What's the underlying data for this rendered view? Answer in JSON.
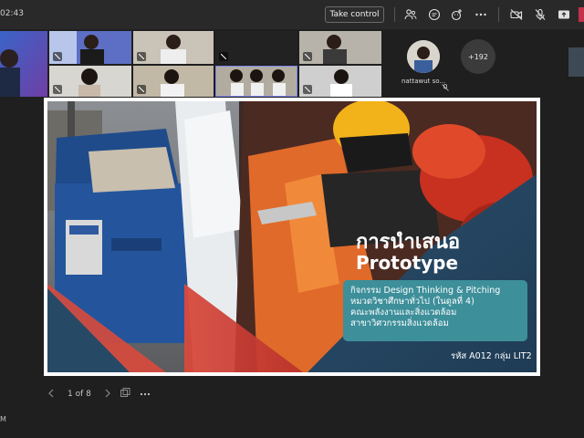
{
  "topbar": {
    "timer": "02:43",
    "take_control_label": "Take control",
    "icons": [
      "people-icon",
      "chat-icon",
      "reactions-icon",
      "more-icon",
      "camera-off-icon",
      "mic-off-icon",
      "share-icon",
      "leave-icon"
    ]
  },
  "gallery": {
    "participant_name": "nattawut so...",
    "overflow_count": "+192"
  },
  "slide": {
    "title_line1": "การนำเสนอ",
    "title_line2": "Prototype",
    "info_lines": [
      "กิจกรรม Design Thinking & Pitching",
      "หมวดวิชาศึกษาทั่วไป (ในดูลที่ 4)",
      "คณะพลังงานและสิ่งแวดล้อม",
      "สาขาวิศวกรรมสิ่งแวดล้อม"
    ],
    "code": "รหัส A012 กลุ่ม LIT2",
    "colors": {
      "teal": "#3d8f9a",
      "red": "#d94a3c",
      "navy": "#264a66"
    }
  },
  "pager": {
    "page_label": "1 of 8"
  },
  "status": {
    "bottom_left": "M"
  }
}
